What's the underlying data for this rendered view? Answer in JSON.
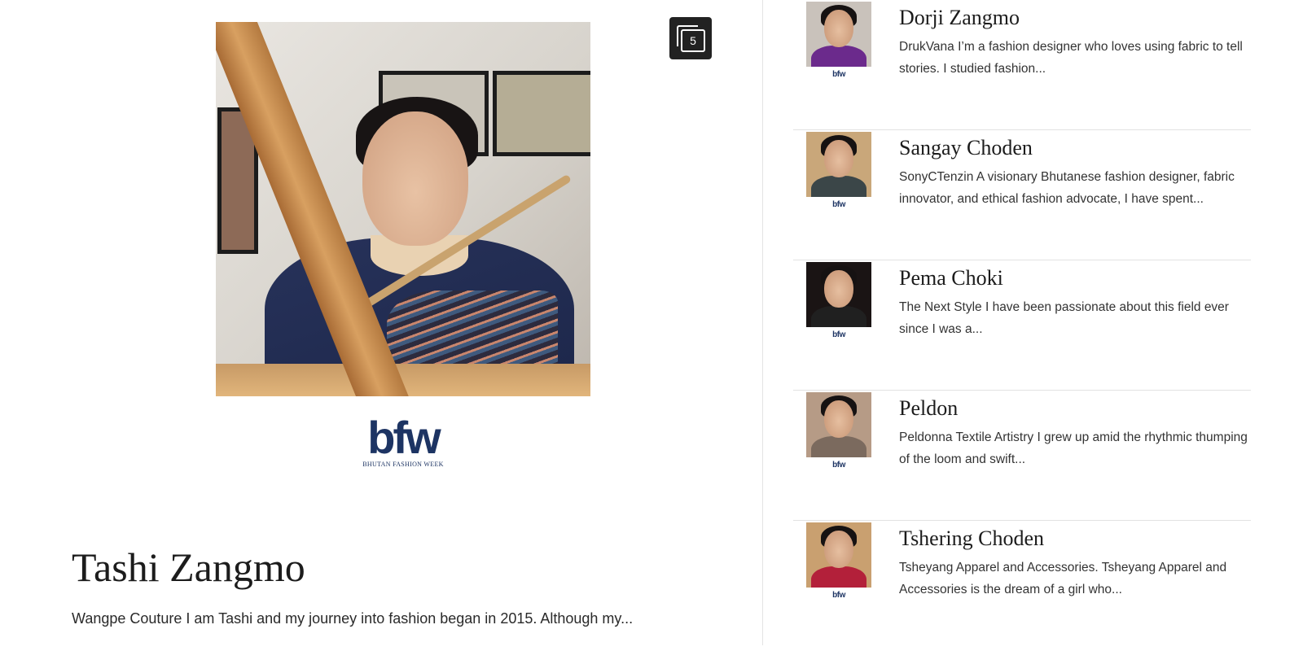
{
  "featured": {
    "gallery_count": "5",
    "logo_text": "bfw",
    "logo_subtitle": "BHUTAN FASHION WEEK",
    "title": "Tashi Zangmo",
    "excerpt": "Wangpe Couture I am Tashi and my journey into fashion began in 2015. Although my..."
  },
  "designers": [
    {
      "name": "Dorji Zangmo",
      "excerpt": "DrukVana I’m a fashion designer who loves using fabric to tell stories. I studied fashion...",
      "thumb_brand": "bfw",
      "bg_color": "#c9c2bb",
      "outfit_color": "#6b2a8c"
    },
    {
      "name": "Sangay Choden",
      "excerpt": "SonyCTenzin A visionary Bhutanese fashion designer, fabric innovator, and ethical fashion advocate, I have spent...",
      "thumb_brand": "bfw",
      "bg_color": "#c9a77a",
      "outfit_color": "#3b4648"
    },
    {
      "name": "Pema Choki",
      "excerpt": "The Next Style I have been passionate about this field ever since I was a...",
      "thumb_brand": "bfw",
      "bg_color": "#1a1414",
      "outfit_color": "#202020"
    },
    {
      "name": "Peldon",
      "excerpt": "Peldonna Textile Artistry I grew up amid the rhythmic thumping of the loom and swift...",
      "thumb_brand": "bfw",
      "bg_color": "#b69b86",
      "outfit_color": "#7b6a5e"
    },
    {
      "name": "Tshering Choden",
      "excerpt": "Tsheyang Apparel and Accessories. Tsheyang Apparel and Accessories is the dream of a girl who...",
      "thumb_brand": "bfw",
      "bg_color": "#c9a070",
      "outfit_color": "#b3203a"
    }
  ]
}
